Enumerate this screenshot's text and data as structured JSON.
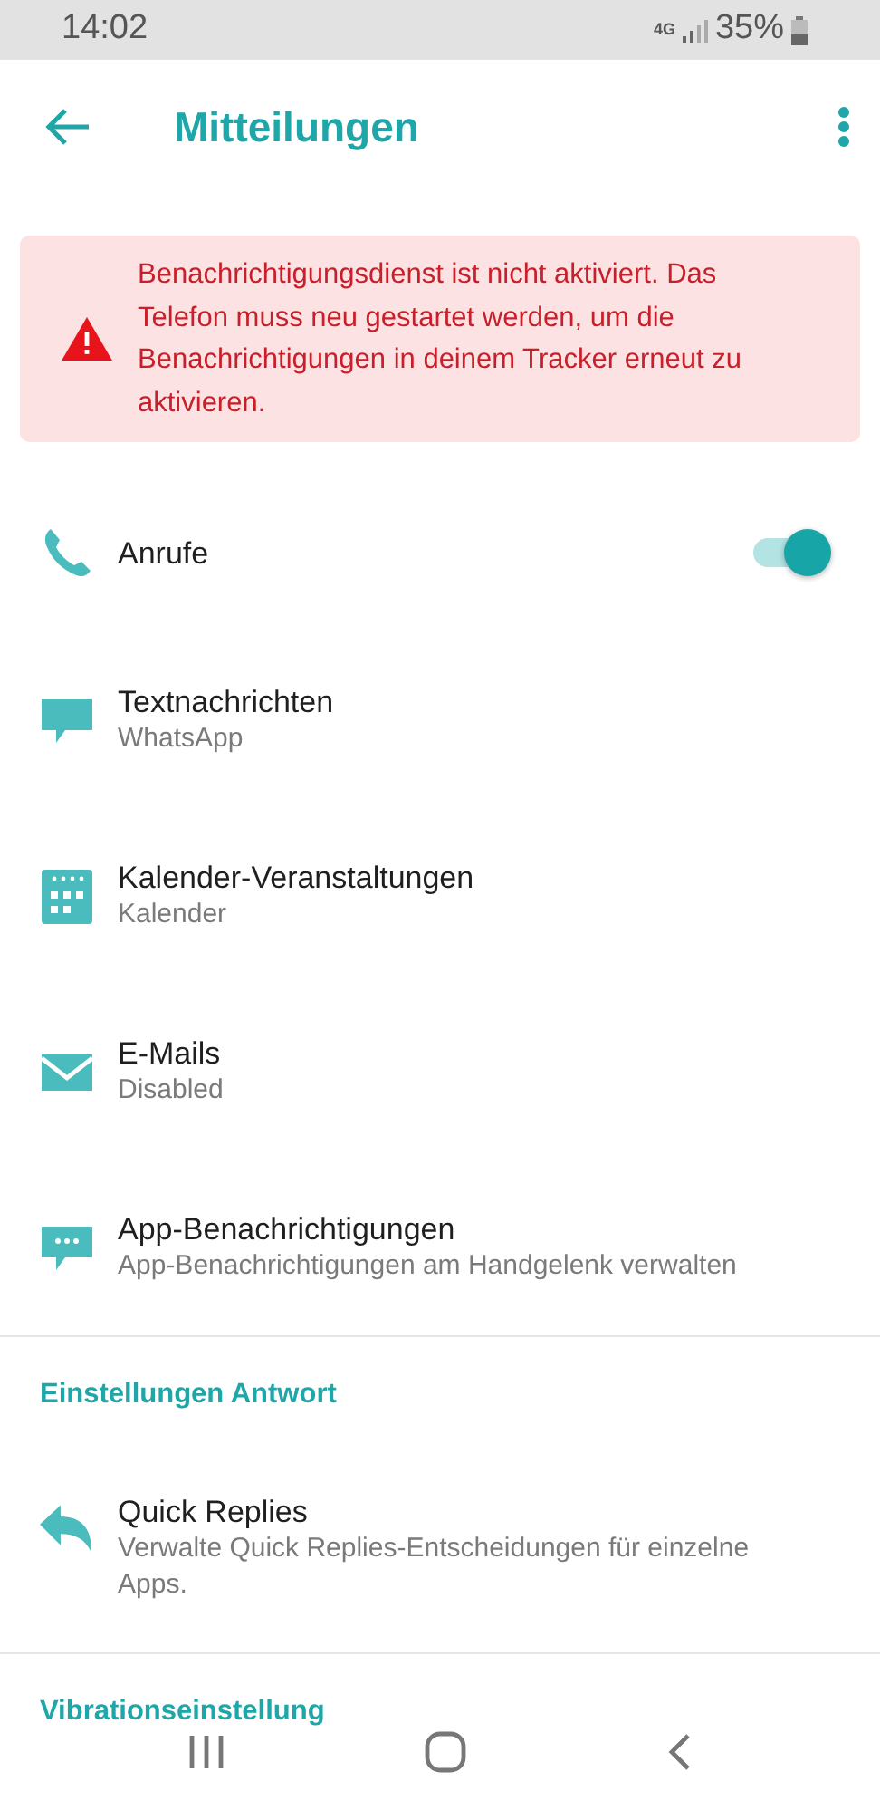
{
  "status_bar": {
    "time": "14:02",
    "network": "4G",
    "battery": "35%"
  },
  "header": {
    "title": "Mitteilungen"
  },
  "alert": {
    "message": "Benachrichtigungsdienst ist nicht aktiviert. Das Telefon muss neu gestartet werden, um die Benachrichtigungen in deinem Tracker erneut zu aktivieren."
  },
  "items": [
    {
      "kind": "toggle",
      "title": "Anrufe",
      "on": true
    },
    {
      "kind": "detail",
      "title": "Textnachrichten",
      "subtitle": "WhatsApp"
    },
    {
      "kind": "detail",
      "title": "Kalender-Veranstaltungen",
      "subtitle": "Kalender"
    },
    {
      "kind": "detail",
      "title": "E-Mails",
      "subtitle": "Disabled"
    },
    {
      "kind": "detail",
      "title": "App-Benachrichtigungen",
      "subtitle": "App-Benachrichtigungen am Handgelenk verwalten"
    }
  ],
  "sections": [
    {
      "header": "Einstellungen Antwort",
      "items": [
        {
          "kind": "detail",
          "title": "Quick Replies",
          "subtitle": "Verwalte Quick Replies-Entscheidungen für einzelne Apps."
        }
      ]
    },
    {
      "header": "Vibrationseinstellung"
    }
  ]
}
